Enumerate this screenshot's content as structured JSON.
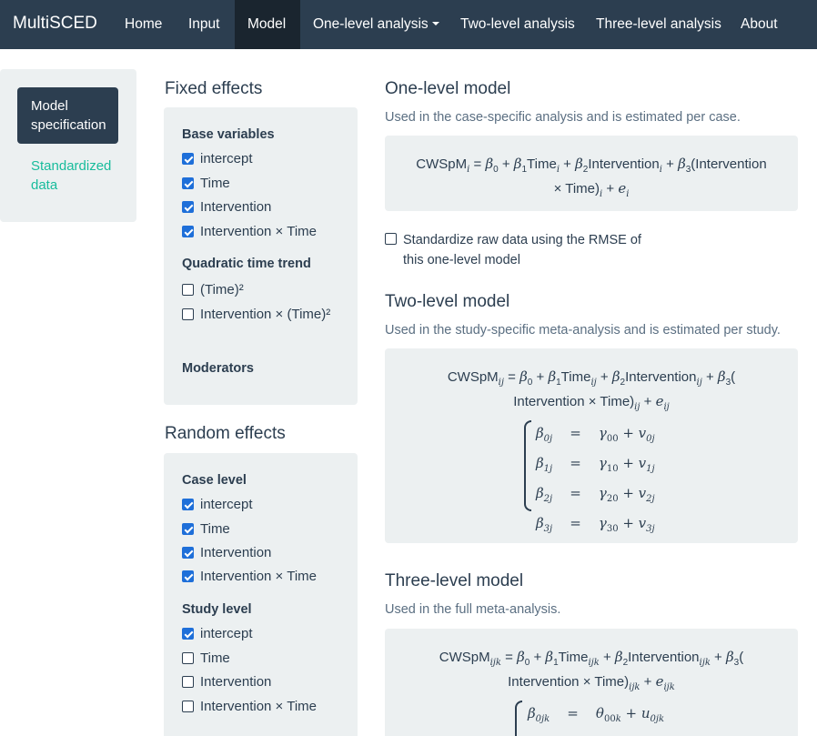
{
  "navbar": {
    "brand": "MultiSCED",
    "items": [
      "Home",
      "Input",
      "Model",
      "One-level analysis",
      "Two-level analysis",
      "Three-level analysis",
      "About"
    ],
    "active": "Model"
  },
  "sidebar": {
    "active_pill": "Model specification",
    "link": "Standardized data"
  },
  "fixed_effects": {
    "title": "Fixed effects",
    "base_title": "Base variables",
    "base": [
      {
        "label": "intercept",
        "checked": true
      },
      {
        "label": "Time",
        "checked": true
      },
      {
        "label": "Intervention",
        "checked": true
      },
      {
        "label": "Intervention × Time",
        "checked": true
      }
    ],
    "quad_title": "Quadratic time trend",
    "quad": [
      {
        "label": "(Time)²",
        "checked": false
      },
      {
        "label": "Intervention × (Time)²",
        "checked": false
      }
    ],
    "moderators_title": "Moderators"
  },
  "random_effects": {
    "title": "Random effects",
    "case_title": "Case level",
    "case": [
      {
        "label": "intercept",
        "checked": true
      },
      {
        "label": "Time",
        "checked": true
      },
      {
        "label": "Intervention",
        "checked": true
      },
      {
        "label": "Intervention × Time",
        "checked": true
      }
    ],
    "study_title": "Study level",
    "study": [
      {
        "label": "intercept",
        "checked": true
      },
      {
        "label": "Time",
        "checked": false
      },
      {
        "label": "Intervention",
        "checked": false
      },
      {
        "label": "Intervention × Time",
        "checked": false
      }
    ]
  },
  "one_level": {
    "title": "One-level model",
    "note": "Used in the case-specific analysis and is estimated per case.",
    "standardize_label": "Standardize raw data using the RMSE of this one-level model",
    "standardize_checked": false
  },
  "two_level": {
    "title": "Two-level model",
    "note": "Used in the study-specific meta-analysis and is estimated per study."
  },
  "three_level": {
    "title": "Three-level model",
    "note": "Used in the full meta-analysis."
  },
  "colors": {
    "navbar": "#2c3e50",
    "navbar_active": "#1a252f",
    "well": "#ecf0f1",
    "link": "#18bc9c",
    "checkbox": "#1e6fd9"
  }
}
